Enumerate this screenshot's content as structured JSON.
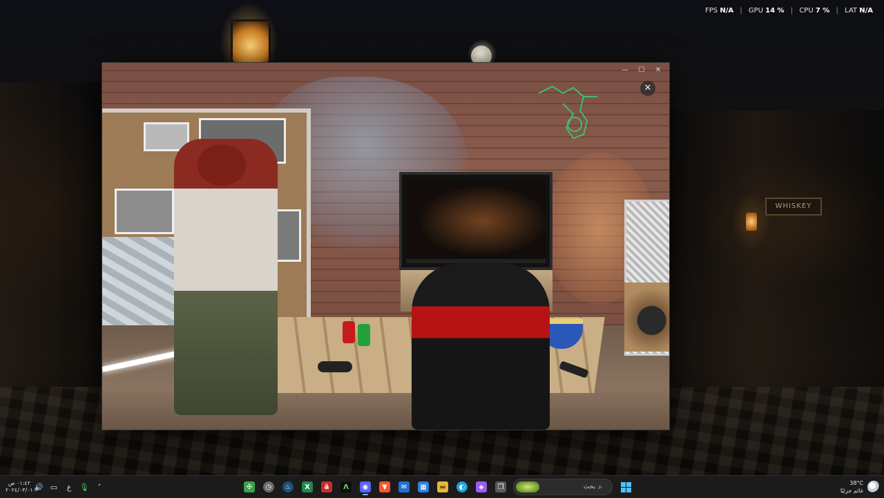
{
  "perf_overlay": {
    "fps_label": "FPS",
    "fps_value": "N/A",
    "gpu_label": "GPU",
    "gpu_value": "14 %",
    "cpu_label": "CPU",
    "cpu_value": "7 %",
    "lat_label": "LAT",
    "lat_value": "N/A",
    "separator": "|"
  },
  "window": {
    "minimize_glyph": "—",
    "maximize_glyph": "☐",
    "close_glyph": "✕",
    "overlay_close_glyph": "✕"
  },
  "wallpaper": {
    "sign_text": "WHISKEY"
  },
  "taskbar": {
    "clock": {
      "time": "٠١:٤٢ ص",
      "date": "٢٠٢٤/٠٣/٠١"
    },
    "tray": [
      {
        "name": "volume-icon",
        "glyph": "🔊"
      },
      {
        "name": "network-icon",
        "glyph": "▭"
      },
      {
        "name": "language-indicator",
        "glyph": "ع"
      },
      {
        "name": "microphone-icon",
        "glyph": "🎙"
      },
      {
        "name": "chevron-up-icon",
        "glyph": "˄"
      }
    ],
    "apps": [
      {
        "name": "app-colorful-icon",
        "glyph": "✣",
        "color": "#3aa34a"
      },
      {
        "name": "app-clock-icon",
        "glyph": "◷",
        "color": "#6a6a6a"
      },
      {
        "name": "steam-icon",
        "glyph": "♨",
        "color": "#1b4f7a"
      },
      {
        "name": "app-green-x-icon",
        "glyph": "X",
        "color": "#1f8a4c"
      },
      {
        "name": "app-red-icon",
        "glyph": "ä",
        "color": "#c72c2c"
      },
      {
        "name": "app-lambda-icon",
        "glyph": "Λ",
        "color": "#0e0e0e"
      },
      {
        "name": "discord-icon",
        "glyph": "◉",
        "color": "#5865f2"
      },
      {
        "name": "brave-icon",
        "glyph": "▼",
        "color": "#fb542b"
      },
      {
        "name": "app-blue-mail-icon",
        "glyph": "✉",
        "color": "#1f6fd1"
      },
      {
        "name": "microsoft-store-icon",
        "glyph": "▦",
        "color": "#2b7fe0"
      },
      {
        "name": "file-explorer-icon",
        "glyph": "▬",
        "color": "#e6b63a"
      },
      {
        "name": "edge-icon",
        "glyph": "◐",
        "color": "#1fa0d8"
      },
      {
        "name": "copilot-icon",
        "glyph": "◈",
        "color": "#9a5cf0"
      },
      {
        "name": "task-view-icon",
        "glyph": "❐",
        "color": "#5a5a5a"
      }
    ],
    "search": {
      "placeholder": "بحث"
    },
    "weather": {
      "temp": "38°C",
      "desc": "غائم جزئيًا"
    }
  }
}
